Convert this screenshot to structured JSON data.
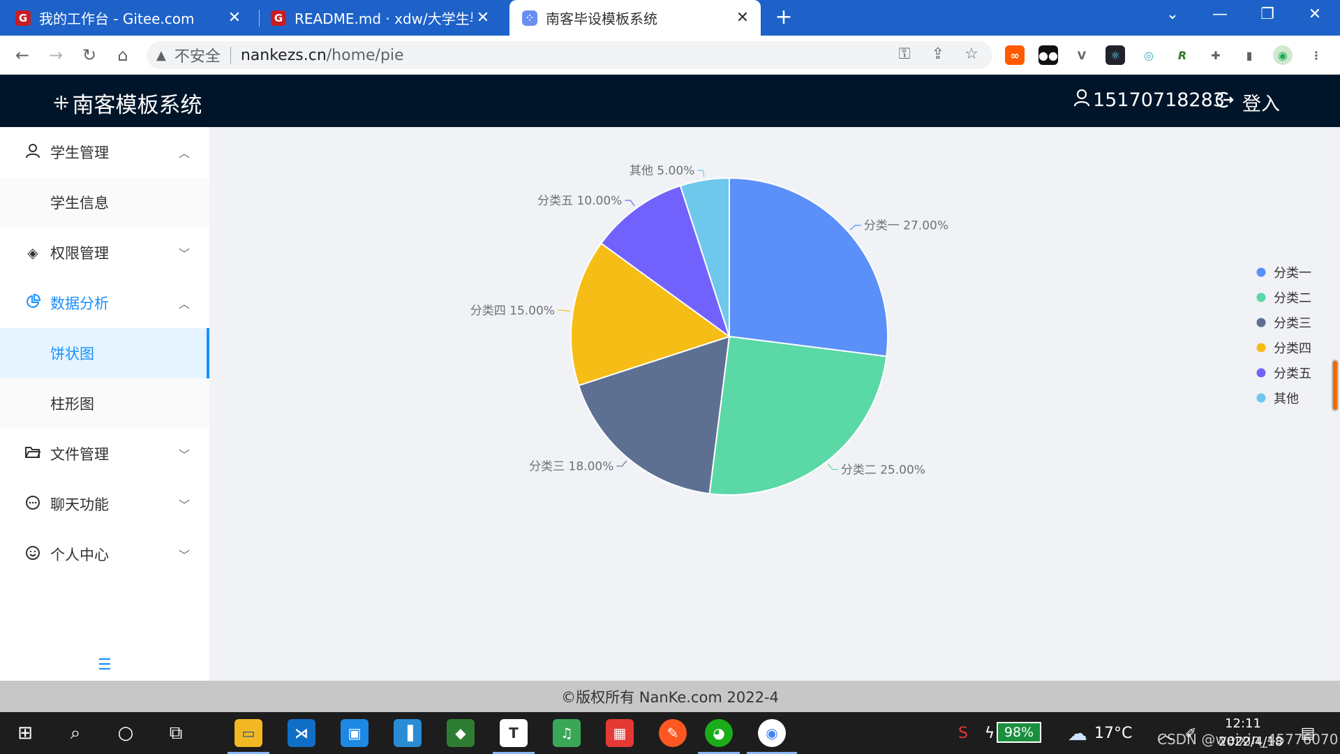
{
  "browser": {
    "tabs": [
      {
        "title": "我的工作台 - Gitee.com",
        "icon": "gitee-icon",
        "active": false
      },
      {
        "title": "README.md · xdw/大学生毕设",
        "icon": "gitee-icon",
        "active": false
      },
      {
        "title": "南客毕设模板系统",
        "icon": "app-icon",
        "active": true
      }
    ],
    "address": {
      "security_label": "不安全",
      "host": "nankezs.cn",
      "path": "/home/pie"
    }
  },
  "app": {
    "brand": "南客模板系统",
    "user_phone": "15170718283",
    "login_label": "登入"
  },
  "sidebar": {
    "menus": [
      {
        "label": "学生管理",
        "icon": "user-icon",
        "expanded": true
      },
      {
        "label": "权限管理",
        "icon": "permission-icon",
        "expanded": false
      },
      {
        "label": "数据分析",
        "icon": "pie-chart-icon",
        "expanded": true
      },
      {
        "label": "文件管理",
        "icon": "folder-icon",
        "expanded": false
      },
      {
        "label": "聊天功能",
        "icon": "chat-icon",
        "expanded": false
      },
      {
        "label": "个人中心",
        "icon": "smile-icon",
        "expanded": false
      }
    ],
    "submenus": {
      "student": [
        "学生信息"
      ],
      "analysis": [
        "饼状图",
        "柱形图"
      ]
    },
    "active_item": "饼状图"
  },
  "chart_data": {
    "type": "pie",
    "categories": [
      "分类一",
      "分类二",
      "分类三",
      "分类四",
      "分类五",
      "其他"
    ],
    "values": [
      27,
      25,
      18,
      15,
      10,
      5
    ],
    "labels": [
      "分类一 27.00%",
      "分类二 25.00%",
      "分类三 18.00%",
      "分类四 15.00%",
      "分类五 10.00%",
      "其他 5.00%"
    ],
    "colors": [
      "#5b8ff9",
      "#5ad8a6",
      "#5d7092",
      "#f6bd16",
      "#7262fd",
      "#6dc8ec"
    ],
    "legend_position": "right"
  },
  "footer": {
    "copyright": "©版权所有 NanKe.com 2022-4"
  },
  "taskbar": {
    "battery": "98%",
    "temperature": "17°C",
    "time": "12:11",
    "date": "2022/4/18",
    "watermark": "CSDN @weixin_45776070"
  }
}
